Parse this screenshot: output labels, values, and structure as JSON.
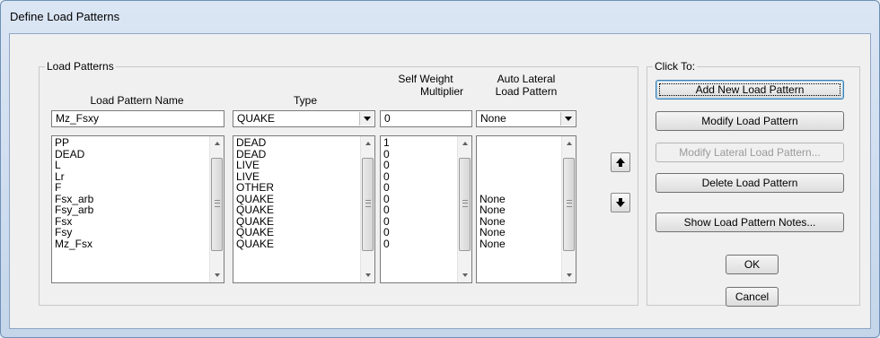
{
  "window": {
    "title": "Define Load Patterns"
  },
  "load_patterns": {
    "legend": "Load Patterns",
    "headers": {
      "name": "Load Pattern Name",
      "type": "Type",
      "self_weight": [
        "Self Weight",
        "Multiplier"
      ],
      "auto_lateral": [
        "Auto Lateral",
        "Load Pattern"
      ]
    },
    "inputs": {
      "name": "Mz_Fsxy",
      "type": "QUAKE",
      "self_weight": "0",
      "auto_lateral": "None"
    },
    "list_names": [
      "PP",
      "DEAD",
      "L",
      "Lr",
      "F",
      "Fsx_arb",
      "Fsy_arb",
      "Fsx",
      "Fsy",
      "Mz_Fsx"
    ],
    "list_types": [
      "DEAD",
      "DEAD",
      "LIVE",
      "LIVE",
      "OTHER",
      "QUAKE",
      "QUAKE",
      "QUAKE",
      "QUAKE",
      "QUAKE"
    ],
    "list_self_weight": [
      "1",
      "0",
      "0",
      "0",
      "0",
      "0",
      "0",
      "0",
      "0",
      "0"
    ],
    "list_auto_lateral": [
      "",
      "",
      "",
      "",
      "",
      "None",
      "None",
      "None",
      "None",
      "None"
    ]
  },
  "click_to": {
    "legend": "Click To:",
    "add": "Add New Load Pattern",
    "modify": "Modify Load Pattern",
    "modify_lateral": "Modify Lateral Load Pattern...",
    "delete": "Delete Load Pattern",
    "notes": "Show Load Pattern Notes..."
  },
  "dialog": {
    "ok": "OK",
    "cancel": "Cancel"
  }
}
